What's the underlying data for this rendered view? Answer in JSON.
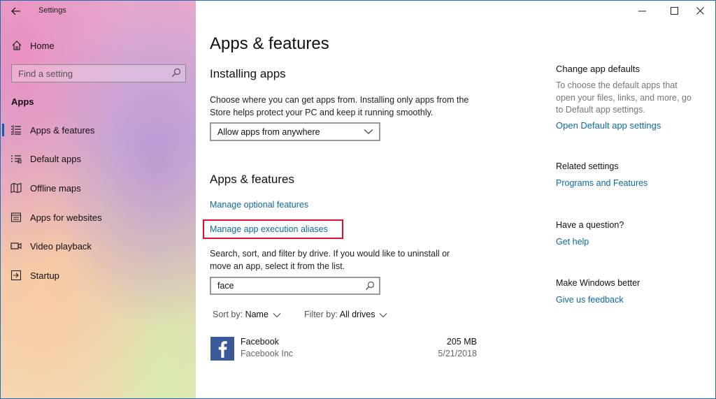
{
  "titlebar": {
    "title": "Settings"
  },
  "sidebar": {
    "home_label": "Home",
    "search_placeholder": "Find a setting",
    "section": "Apps",
    "items": [
      {
        "label": "Apps & features",
        "icon": "apps-features-icon",
        "selected": true
      },
      {
        "label": "Default apps",
        "icon": "default-apps-icon",
        "selected": false
      },
      {
        "label": "Offline maps",
        "icon": "offline-maps-icon",
        "selected": false
      },
      {
        "label": "Apps for websites",
        "icon": "apps-for-websites-icon",
        "selected": false
      },
      {
        "label": "Video playback",
        "icon": "video-playback-icon",
        "selected": false
      },
      {
        "label": "Startup",
        "icon": "startup-icon",
        "selected": false
      }
    ]
  },
  "main": {
    "page_title": "Apps & features",
    "installing": {
      "heading": "Installing apps",
      "description_line1": "Choose where you can get apps from. Installing only apps from the",
      "description_line2": "Store helps protect your PC and keep it running smoothly.",
      "dropdown_value": "Allow apps from anywhere"
    },
    "apps_features": {
      "heading": "Apps & features",
      "optional_link": "Manage optional features",
      "aliases_link": "Manage app execution aliases",
      "description_line1": "Search, sort, and filter by drive. If you would like to uninstall or",
      "description_line2": "move an app, select it from the list.",
      "search_value": "face",
      "sort_label": "Sort by:",
      "sort_value": "Name",
      "filter_label": "Filter by:",
      "filter_value": "All drives"
    },
    "apps": [
      {
        "name": "Facebook",
        "publisher": "Facebook Inc",
        "size": "205 MB",
        "date": "5/21/2018",
        "icon": "facebook-logo-icon"
      }
    ]
  },
  "right_column": {
    "defaults_heading": "Change app defaults",
    "defaults_desc_line1": "To choose the default apps that",
    "defaults_desc_line2": "open your files, links, and more, go",
    "defaults_desc_line3": "to Default app settings.",
    "defaults_link": "Open Default app settings",
    "related_heading": "Related settings",
    "related_link": "Programs and Features",
    "question_heading": "Have a question?",
    "help_link": "Get help",
    "better_heading": "Make Windows better",
    "feedback_link": "Give us feedback"
  },
  "colors": {
    "accent": "#0063b1",
    "link": "#0b6aa2",
    "highlight_border": "#e0102a",
    "facebook": "#3b5998"
  }
}
